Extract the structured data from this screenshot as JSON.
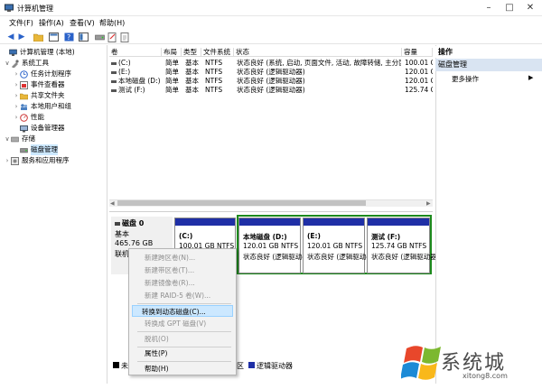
{
  "window": {
    "title": "计算机管理"
  },
  "menu": [
    "文件(F)",
    "操作(A)",
    "查看(V)",
    "帮助(H)"
  ],
  "tree": {
    "root": "计算机管理 (本地)",
    "system_tools": "系统工具",
    "task_scheduler": "任务计划程序",
    "event_viewer": "事件查看器",
    "shared_folders": "共享文件夹",
    "local_users": "本地用户和组",
    "performance": "性能",
    "device_manager": "设备管理器",
    "storage": "存储",
    "disk_management": "磁盘管理",
    "services_apps": "服务和应用程序"
  },
  "volume_table": {
    "columns": [
      "卷",
      "布局",
      "类型",
      "文件系统",
      "状态",
      "容量"
    ],
    "rows": [
      [
        "(C:)",
        "简单",
        "基本",
        "NTFS",
        "状态良好 (系统, 启动, 页面文件, 活动, 故障转储, 主分区)",
        "100.01 G"
      ],
      [
        "(E:)",
        "简单",
        "基本",
        "NTFS",
        "状态良好 (逻辑驱动器)",
        "120.01 G"
      ],
      [
        "本地磁盘 (D:)",
        "简单",
        "基本",
        "NTFS",
        "状态良好 (逻辑驱动器)",
        "120.01 G"
      ],
      [
        "测试 (F:)",
        "简单",
        "基本",
        "NTFS",
        "状态良好 (逻辑驱动器)",
        "125.74 G"
      ]
    ]
  },
  "disk": {
    "name": "磁盘 0",
    "type": "基本",
    "size": "465.76 GB",
    "status": "联机",
    "partitions": [
      {
        "label": "(C:)",
        "size": "100.01 GB NTFS",
        "status": ""
      },
      {
        "label": "本地磁盘  (D:)",
        "size": "120.01 GB NTFS",
        "status": "状态良好 (逻辑驱动器)"
      },
      {
        "label": "(E:)",
        "size": "120.01 GB NTFS",
        "status": "状态良好 (逻辑驱动器)"
      },
      {
        "label": "测试  (F:)",
        "size": "125.74 GB NTFS",
        "status": "状态良好 (逻辑驱动器)"
      }
    ]
  },
  "context_menu": {
    "new_spanned": "新建跨区卷(N)...",
    "new_striped": "新建带区卷(T)...",
    "new_mirror": "新建镜像卷(R)...",
    "new_raid5": "新建 RAID-5 卷(W)...",
    "convert_dynamic": "转换到动态磁盘(C)...",
    "convert_gpt": "转换成 GPT 磁盘(V)",
    "offline": "脱机(O)",
    "properties": "属性(P)",
    "help": "帮助(H)"
  },
  "legend": {
    "unallocated_partial": "未",
    "logical_partial": "区",
    "logical_drive": "逻辑驱动器"
  },
  "actions": {
    "header": "操作",
    "section": "磁盘管理",
    "more": "更多操作"
  },
  "watermark": {
    "text": "系统城",
    "url": "xitong8.com"
  },
  "colors": {
    "partition_bar": "#1f2fa6",
    "extended_frame": "#1d8a1d",
    "selection": "#cce8ff"
  },
  "icons": [
    "computer-management-icon",
    "minimize-icon",
    "maximize-icon",
    "close-icon",
    "back-icon",
    "forward-icon",
    "folder-icon",
    "console-icon",
    "help-icon",
    "disk-icon",
    "properties-icon"
  ]
}
